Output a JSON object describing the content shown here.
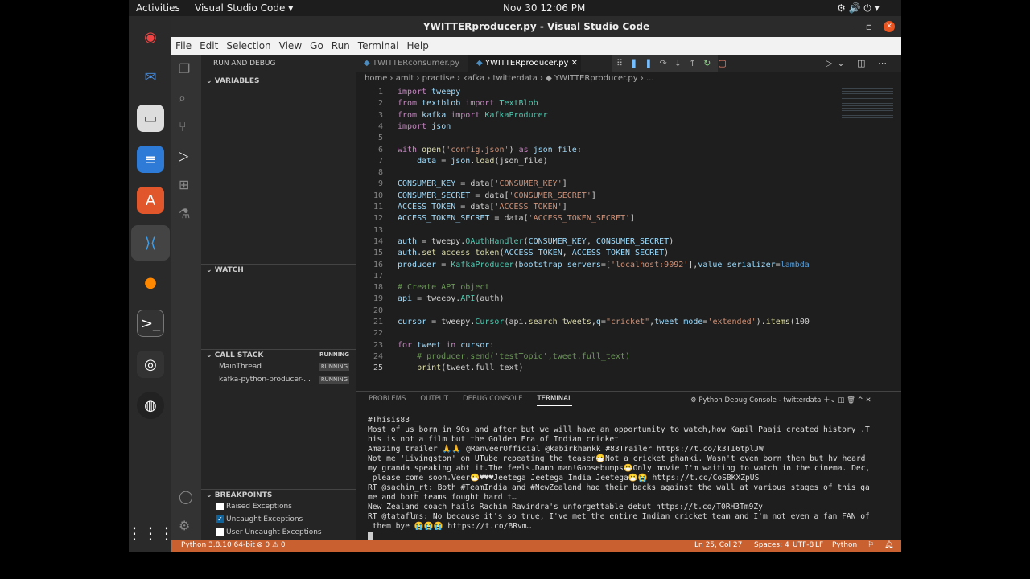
{
  "topbar": {
    "activities": "Activities",
    "app": "Visual Studio Code ▾",
    "clock": "Nov 30  12:06 PM"
  },
  "window": {
    "title": "YWITTERproducer.py - Visual Studio Code"
  },
  "menu": [
    "File",
    "Edit",
    "Selection",
    "View",
    "Go",
    "Run",
    "Terminal",
    "Help"
  ],
  "sidebar": {
    "title": "RUN AND DEBUG",
    "variables": "VARIABLES",
    "watch": "WATCH",
    "callstack": "CALL STACK",
    "callstack_status": "RUNNING",
    "threads": [
      {
        "name": "MainThread",
        "status": "RUNNING"
      },
      {
        "name": "kafka-python-producer-...",
        "status": "RUNNING"
      }
    ],
    "breakpoints": "BREAKPOINTS",
    "bp_items": [
      {
        "label": "Raised Exceptions",
        "checked": false
      },
      {
        "label": "Uncaught Exceptions",
        "checked": true
      },
      {
        "label": "User Uncaught Exceptions",
        "checked": false
      }
    ]
  },
  "tabs": [
    {
      "label": "TWITTERconsumer.py"
    },
    {
      "label": "YWITTERproducer.py"
    }
  ],
  "breadcrumb": "home › amit › practise › kafka › twitterdata › ◆ YWITTERproducer.py › ...",
  "code": [
    [
      [
        "import ",
        "k"
      ],
      [
        "tweepy",
        "v"
      ]
    ],
    [
      [
        "from ",
        "k"
      ],
      [
        "textblob ",
        "v"
      ],
      [
        "import ",
        "k"
      ],
      [
        "TextBlob",
        "t"
      ]
    ],
    [
      [
        "from ",
        "k"
      ],
      [
        "kafka ",
        "v"
      ],
      [
        "import ",
        "k"
      ],
      [
        "KafkaProducer",
        "t"
      ]
    ],
    [
      [
        "import ",
        "k"
      ],
      [
        "json",
        "v"
      ]
    ],
    [],
    [
      [
        "with ",
        "k"
      ],
      [
        "open",
        "f"
      ],
      [
        "(",
        "p"
      ],
      [
        "'config.json'",
        "s"
      ],
      [
        ") ",
        "p"
      ],
      [
        "as ",
        "k"
      ],
      [
        "json_file",
        "v"
      ],
      [
        ":",
        "p"
      ]
    ],
    [
      [
        "    data ",
        "v"
      ],
      [
        "= ",
        "p"
      ],
      [
        "json",
        "v"
      ],
      [
        ".",
        "p"
      ],
      [
        "load",
        "f"
      ],
      [
        "(json_file)",
        "p"
      ]
    ],
    [],
    [
      [
        "CONSUMER_KEY ",
        "v"
      ],
      [
        "= data[",
        "p"
      ],
      [
        "'CONSUMER_KEY'",
        "s"
      ],
      [
        "]",
        "p"
      ]
    ],
    [
      [
        "CONSUMER_SECRET ",
        "v"
      ],
      [
        "= data[",
        "p"
      ],
      [
        "'CONSUMER_SECRET'",
        "s"
      ],
      [
        "]",
        "p"
      ]
    ],
    [
      [
        "ACCESS_TOKEN ",
        "v"
      ],
      [
        "= data[",
        "p"
      ],
      [
        "'ACCESS_TOKEN'",
        "s"
      ],
      [
        "]",
        "p"
      ]
    ],
    [
      [
        "ACCESS_TOKEN_SECRET ",
        "v"
      ],
      [
        "= data[",
        "p"
      ],
      [
        "'ACCESS_TOKEN_SECRET'",
        "s"
      ],
      [
        "]",
        "p"
      ]
    ],
    [],
    [
      [
        "auth ",
        "v"
      ],
      [
        "= tweepy.",
        "p"
      ],
      [
        "OAuthHandler",
        "t"
      ],
      [
        "(",
        "p"
      ],
      [
        "CONSUMER_KEY",
        "v"
      ],
      [
        ", ",
        "p"
      ],
      [
        "CONSUMER_SECRET",
        "v"
      ],
      [
        ")",
        "p"
      ]
    ],
    [
      [
        "auth",
        "v"
      ],
      [
        ".",
        "p"
      ],
      [
        "set_access_token",
        "f"
      ],
      [
        "(",
        "p"
      ],
      [
        "ACCESS_TOKEN",
        "v"
      ],
      [
        ", ",
        "p"
      ],
      [
        "ACCESS_TOKEN_SECRET",
        "v"
      ],
      [
        ")",
        "p"
      ]
    ],
    [
      [
        "producer ",
        "v"
      ],
      [
        "= ",
        "p"
      ],
      [
        "KafkaProducer",
        "t"
      ],
      [
        "(",
        "p"
      ],
      [
        "bootstrap_servers",
        "v"
      ],
      [
        "=[",
        "p"
      ],
      [
        "'localhost:9092'",
        "s"
      ],
      [
        "],",
        "p"
      ],
      [
        "value_serializer",
        "v"
      ],
      [
        "=",
        "p"
      ],
      [
        "lambda",
        "b"
      ]
    ],
    [],
    [
      [
        "# Create API object",
        "c"
      ]
    ],
    [
      [
        "api ",
        "v"
      ],
      [
        "= tweepy.",
        "p"
      ],
      [
        "API",
        "t"
      ],
      [
        "(auth)",
        "p"
      ]
    ],
    [],
    [
      [
        "cursor ",
        "v"
      ],
      [
        "= tweepy.",
        "p"
      ],
      [
        "Cursor",
        "t"
      ],
      [
        "(api.",
        "p"
      ],
      [
        "search_tweets",
        "f"
      ],
      [
        ",",
        "p"
      ],
      [
        "q",
        "v"
      ],
      [
        "=",
        "p"
      ],
      [
        "\"cricket\"",
        "s"
      ],
      [
        ",",
        "p"
      ],
      [
        "tweet_mode",
        "v"
      ],
      [
        "=",
        "p"
      ],
      [
        "'extended'",
        "s"
      ],
      [
        ").",
        "p"
      ],
      [
        "items",
        "f"
      ],
      [
        "(100",
        "p"
      ]
    ],
    [],
    [
      [
        "for ",
        "k"
      ],
      [
        "tweet ",
        "v"
      ],
      [
        "in ",
        "k"
      ],
      [
        "cursor",
        "v"
      ],
      [
        ":",
        "p"
      ]
    ],
    [
      [
        "    # producer.send('testTopic',tweet.full_text)",
        "c"
      ]
    ],
    [
      [
        "    ",
        "p"
      ],
      [
        "print",
        "f"
      ],
      [
        "(tweet.full_text)",
        "p"
      ]
    ]
  ],
  "panel": {
    "tabs": [
      "PROBLEMS",
      "OUTPUT",
      "DEBUG CONSOLE",
      "TERMINAL"
    ],
    "terminal_name": "Python Debug Console - twitterdata"
  },
  "terminal": [
    "#Thisis83",
    "Most of us born in 90s and after but we will have an opportunity to watch,how Kapil Paaji created history .T",
    "his is not a film but the Golden Era of Indian cricket",
    "Amazing trailer 🙏🙏 @RanveerOfficial @kabirkhankk #83Trailer https://t.co/k3TI6tplJW",
    "Not me 'Livingston' on UTube repeating the teaser😷Not a cricket phanki. Wasn't even born then but hv heard",
    "my granda speaking abt it.The feels.Damn man!Goosebumps😷Only movie I'm waiting to watch in the cinema. Dec,",
    " please come soon.Veer😷♥♥♥Jeetega Jeetega India Jeetega😷😭 https://t.co/CoSBKXZpUS",
    "RT @sachin_rt: Both #TeamIndia and #NewZealand had their backs against the wall at various stages of this ga",
    "me and both teams fought hard t…",
    "New Zealand coach hails Rachin Ravindra's unforgettable debut https://t.co/T0RH3Tm9Zy",
    "RT @tataflms: No because it's so true, I've met the entire Indian cricket team and I'm not even a fan FAN of",
    " them bye 😭😭😭 https://t.co/BRvm…"
  ],
  "status": {
    "python": "Python 3.8.10 64-bit",
    "problems": "⊗ 0 ⚠ 0",
    "cursor": "Ln 25, Col 27",
    "spaces": "Spaces: 4",
    "encoding": "UTF-8",
    "eol": "LF",
    "language": "Python"
  },
  "colors": {
    "status": "#c8602f",
    "accent": "#007acc"
  }
}
